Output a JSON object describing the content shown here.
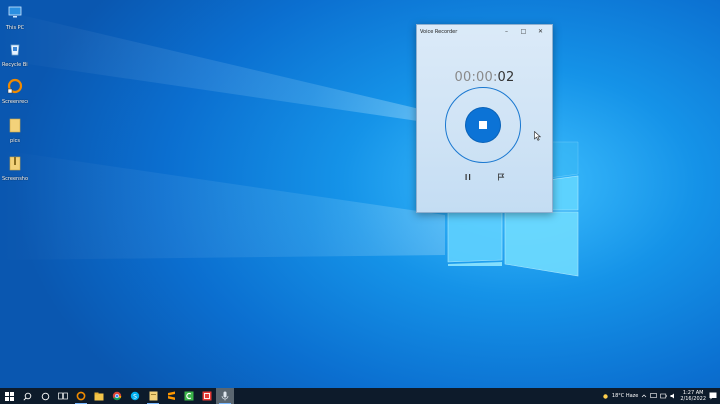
{
  "desktop": {
    "icons": [
      {
        "label": "This PC",
        "icon": "computer-icon"
      },
      {
        "label": "Recycle Bin",
        "icon": "recycle-bin-icon"
      },
      {
        "label": "Screenrecorder",
        "icon": "app-shortcut-icon"
      },
      {
        "label": "pics",
        "icon": "folder-icon"
      },
      {
        "label": "Screenshots",
        "icon": "zip-folder-icon"
      }
    ]
  },
  "recorder": {
    "title": "Voice Recorder",
    "minimize": "–",
    "maximize": "□",
    "close": "✕",
    "timer_dim": "00:00:",
    "timer_bright": "02",
    "stop_label": "Stop recording",
    "pause_label": "Pause",
    "flag_label": "Add a marker"
  },
  "taskbar": {
    "apps": [
      "start",
      "search",
      "task-view",
      "firefox",
      "file-explorer",
      "chrome",
      "skype",
      "notes",
      "sublime",
      "camtasia",
      "recorder",
      "voice-recorder"
    ],
    "tray": {
      "weather": "18°C  Haze",
      "time": "1:27 AM",
      "date": "2/16/2022"
    }
  },
  "colors": {
    "accent": "#0c73d6",
    "taskbar": "#0d1b2b"
  }
}
